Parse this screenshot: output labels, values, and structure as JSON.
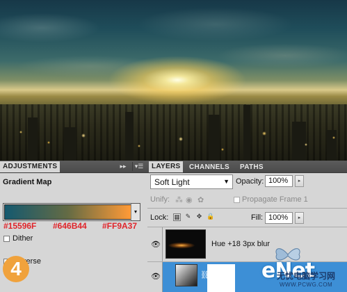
{
  "adjustments_panel": {
    "tab_label": "ADJUSTMENTS",
    "title": "Gradient Map",
    "gradient": {
      "stops": [
        "#15596F",
        "#646B44",
        "#FF9A37"
      ],
      "stop_labels": [
        "#15596F",
        "#646B44",
        "#FF9A37"
      ]
    },
    "dither_label": "Dither",
    "reverse_label": "Reverse",
    "step_number": "4"
  },
  "layers_panel": {
    "tabs": [
      "LAYERS",
      "CHANNELS",
      "PATHS"
    ],
    "active_tab": "LAYERS",
    "blend_mode": "Soft Light",
    "opacity_label": "Opacity:",
    "opacity_value": "100%",
    "unify_label": "Unify:",
    "propagate_label": "Propagate Frame 1",
    "lock_label": "Lock:",
    "fill_label": "Fill:",
    "fill_value": "100%",
    "layers": [
      {
        "name": "Hue +18 3px blur",
        "visible": true,
        "selected": false
      },
      {
        "name": "",
        "visible": true,
        "selected": true
      }
    ]
  },
  "watermark": {
    "logo": "eNet",
    "chinese": "无忧电脑学习网",
    "url": "WWW.PCWG.COM"
  },
  "colors": {
    "panel_bg": "#d6d6d6",
    "tab_bar": "#4f4f4f",
    "selected_layer": "#3d8fd6",
    "stop_label": "#e0242a",
    "step_badge": "#f0a23c"
  }
}
